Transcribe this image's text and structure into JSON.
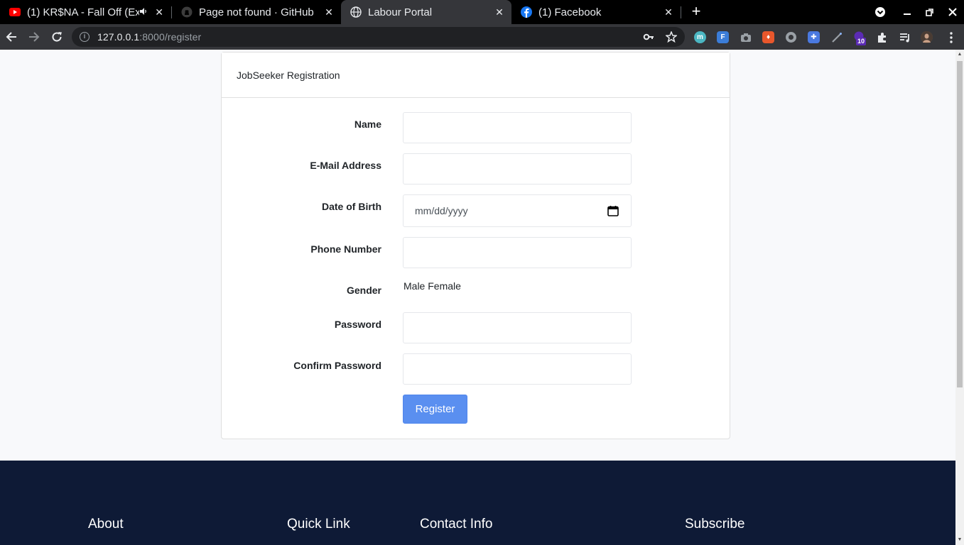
{
  "browser": {
    "tabs": [
      {
        "title": "(1) KR$NA - Fall Off (Ex",
        "favicon": "youtube-icon",
        "active": false,
        "audio": true
      },
      {
        "title": "Page not found · GitHub",
        "favicon": "github-icon",
        "active": false
      },
      {
        "title": "Labour Portal",
        "favicon": "globe-icon",
        "active": true
      },
      {
        "title": "(1) Facebook",
        "favicon": "facebook-icon",
        "active": false
      }
    ],
    "address": {
      "host": "127.0.0.1",
      "rest": ":8000/register"
    },
    "extension_badge": "10"
  },
  "card": {
    "header": "JobSeeker Registration"
  },
  "form": {
    "name_label": "Name",
    "email_label": "E-Mail Address",
    "dob_label": "Date of Birth",
    "dob_placeholder": "mm/dd/yyyy",
    "phone_label": "Phone Number",
    "gender_label": "Gender",
    "gender_options": "Male Female",
    "password_label": "Password",
    "confirm_label": "Confirm Password",
    "submit_label": "Register"
  },
  "footer": {
    "about": "About",
    "quick_link": "Quick Link",
    "contact": "Contact Info",
    "subscribe": "Subscribe"
  },
  "colors": {
    "button": "#5a8ff0",
    "footer_bg": "#0e1a36",
    "page_bg": "#f8f9fb"
  }
}
